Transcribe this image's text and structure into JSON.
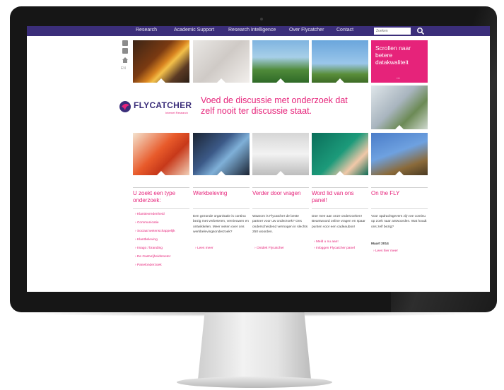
{
  "nav": {
    "items": [
      "Research",
      "Academic Support",
      "Research Intelligence",
      "Over Flycatcher",
      "Contact"
    ],
    "search_placeholder": "Zoeken"
  },
  "sidebar_tools": {
    "label": "EN"
  },
  "hero": {
    "promo_text": "Scrollen naar betere datakwaliteit",
    "promo_arrow": "→",
    "logo_text": "FLYCATCHER",
    "logo_sub": "Internet Research",
    "tagline": "Voed de discussie met onderzoek dat zelf nooit ter discussie staat."
  },
  "columns": [
    {
      "title": "U zoekt een type onderzoek:",
      "items": [
        "Klanttevredenheid",
        "Communicatie",
        "Sociaal wetenschappelijk",
        "Klantbeleving",
        "Imago / branding",
        "De Gastvrijheidsmeter",
        "Panelonderzoek"
      ]
    },
    {
      "title": "Werkbeleving",
      "body": "Een gezonde organisatie is continu bezig met verbeteren, vernieuwen en ontwikkelen. Meer weten over ons werkbelevingsonderzoek?",
      "links": [
        "Lees meer"
      ]
    },
    {
      "title": "Verder door vragen",
      "body": "Waarom is Flycatcher de beste partner voor uw onderzoek? Ons onderscheidend vermogen in slechts 250 woorden.",
      "links": [
        "Ontdek Flycatcher"
      ]
    },
    {
      "title": "Word lid van ons panel!",
      "body": "Doe mee aan onze onderzoeken! Beantwoord online vragen en spaar punten voor een cadeaubon!",
      "links": [
        "Meld u nu aan!",
        "Inloggen Flycatcher panel"
      ]
    },
    {
      "title": "On the FLY",
      "body": "Voor opdrachtgevers zijn we continu op zoek naar antwoorden. Wat houdt ons zelf bezig?",
      "date": "Maart 2014",
      "links": [
        "Lees hier meer"
      ]
    }
  ],
  "colors": {
    "brand_purple": "#3b2e7a",
    "brand_pink": "#e6237a"
  }
}
